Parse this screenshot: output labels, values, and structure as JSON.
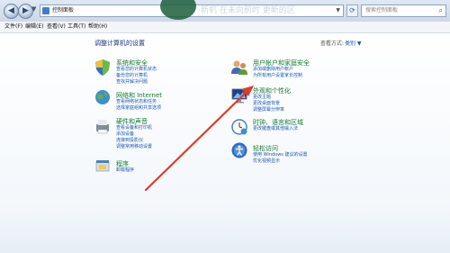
{
  "titlebar": {
    "address": "控制面板",
    "search_placeholder": "搜索控制面板",
    "overlay_text": "新机 在未向前时 更新的区"
  },
  "menu": [
    "文件(F)",
    "编辑(E)",
    "查看(V)",
    "工具(T)",
    "帮助(H)"
  ],
  "main": {
    "title": "调整计算机的设置",
    "view_by_label": "查看方式:",
    "view_by_value": "类别 ▼"
  },
  "categories": [
    {
      "title": "系统和安全",
      "links": [
        "查看您的计算机状态",
        "备份您的计算机",
        "查找并解决问题"
      ]
    },
    {
      "title": "网络和 Internet",
      "links": [
        "查看网络状态和任务",
        "选择家庭组和共享选项"
      ]
    },
    {
      "title": "硬件和声音",
      "links": [
        "查看设备和打印机",
        "添加设备",
        "连接到投影仪",
        "调整常用移动设置"
      ]
    },
    {
      "title": "程序",
      "links": [
        "卸载程序"
      ]
    },
    {
      "title": "用户帐户和家庭安全",
      "links": [
        "添加或删除用户帐户",
        "为所有用户设置家长控制"
      ]
    },
    {
      "title": "外观和个性化",
      "links": [
        "更改主题",
        "更改桌面背景",
        "调整屏幕分辨率"
      ]
    },
    {
      "title": "时钟、语言和区域",
      "links": [
        "更改键盘或其他输入法"
      ]
    },
    {
      "title": "轻松访问",
      "links": [
        "使用 Windows 建议的设置",
        "优化视频显示"
      ]
    }
  ],
  "colors": {
    "category_title": "#137a2a",
    "link": "#1a57b4",
    "annotation_arrow": "#e23a2b"
  }
}
